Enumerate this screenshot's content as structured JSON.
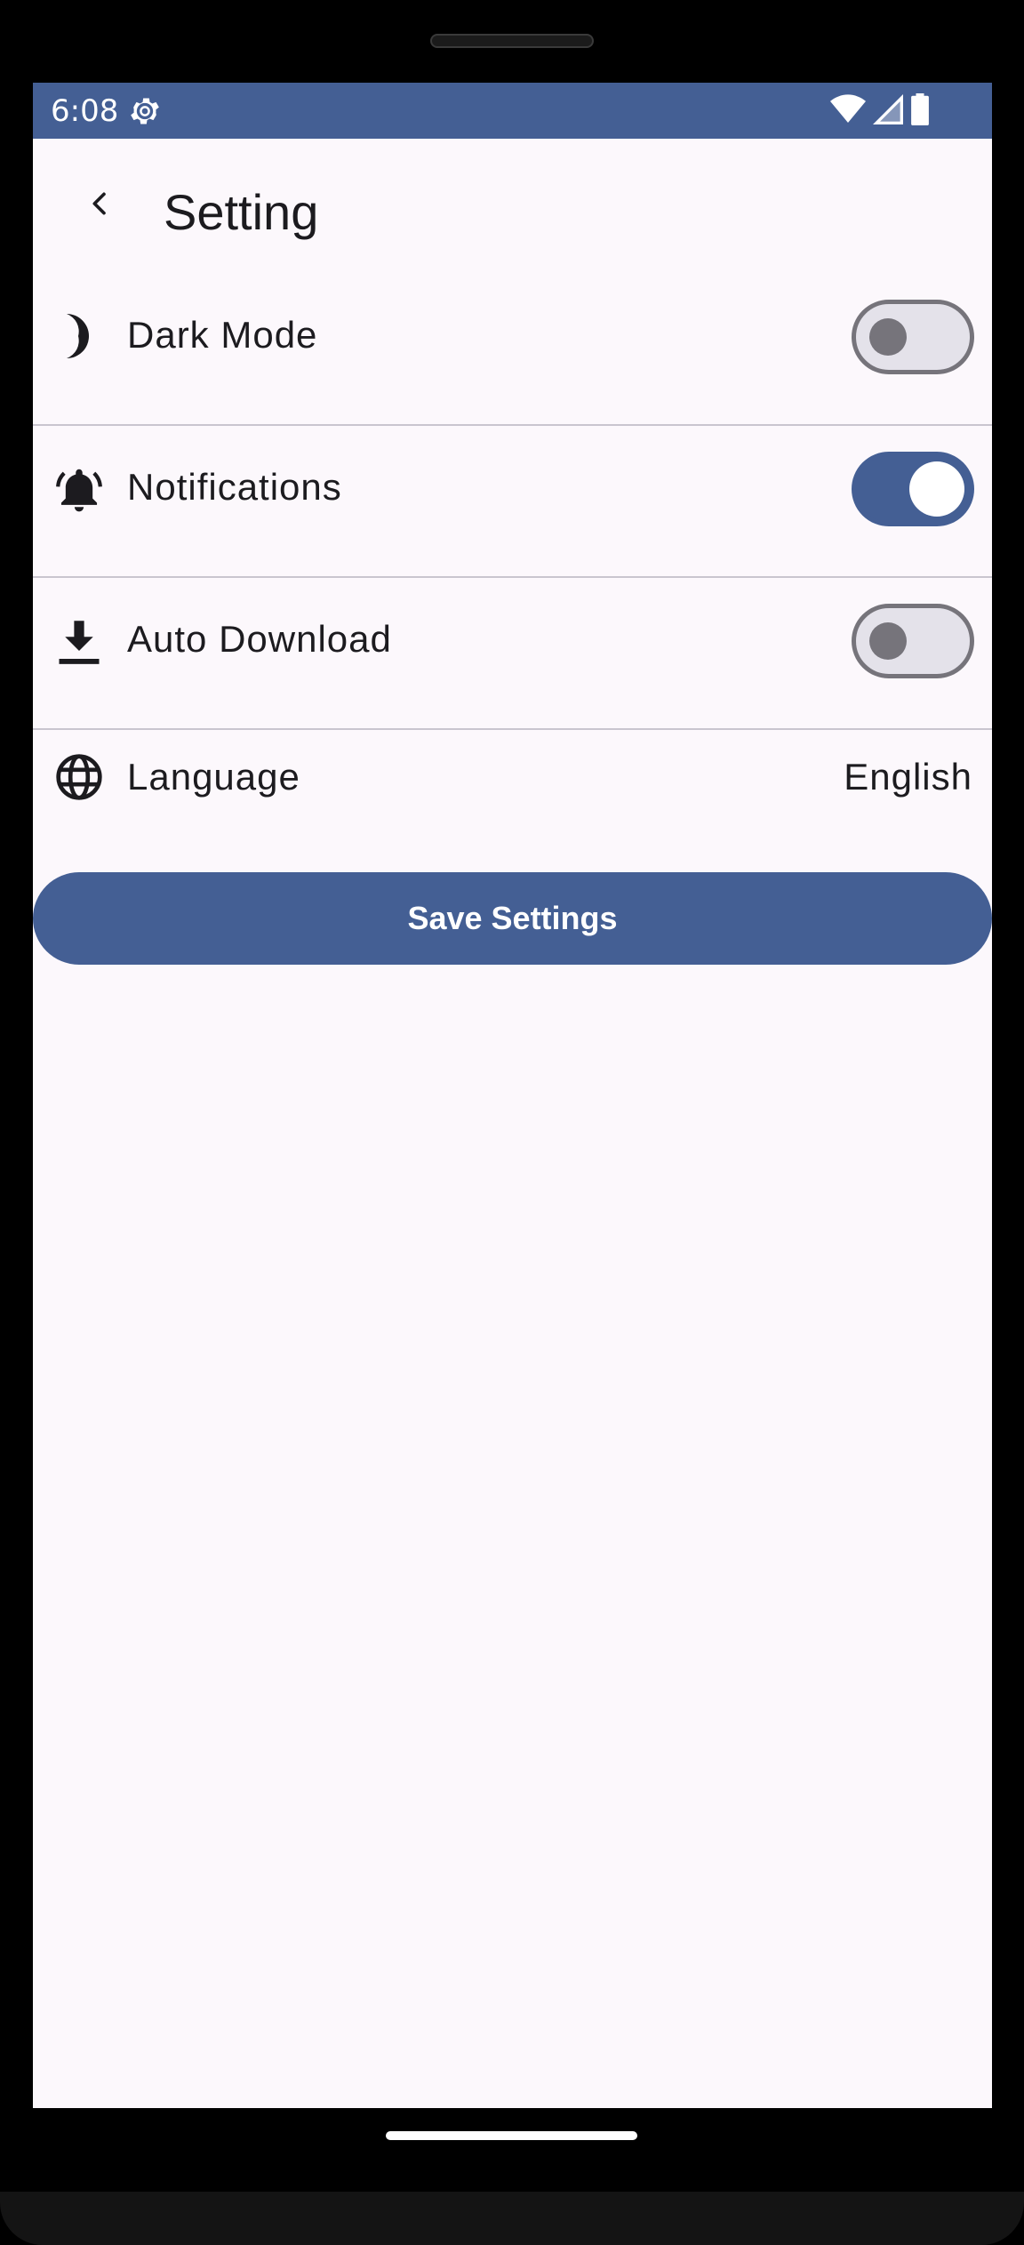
{
  "status_bar": {
    "time": "6:08",
    "icons": [
      "settings-gear-icon",
      "wifi-icon",
      "signal-icon",
      "battery-icon"
    ],
    "background": "#445f94"
  },
  "header": {
    "title": "Setting",
    "back_icon": "chevron-left-icon"
  },
  "settings": [
    {
      "label": "Dark Mode",
      "icon": "moon-icon",
      "type": "toggle",
      "enabled": false
    },
    {
      "label": "Notifications",
      "icon": "bell-ringing-icon",
      "type": "toggle",
      "enabled": true
    },
    {
      "label": "Auto Download",
      "icon": "download-icon",
      "type": "toggle",
      "enabled": false
    },
    {
      "label": "Language",
      "icon": "globe-icon",
      "type": "value",
      "value": "English"
    }
  ],
  "save_button": {
    "label": "Save Settings"
  },
  "colors": {
    "primary": "#445f94",
    "surface": "#fcf8fc",
    "on_surface": "#1c1b1f",
    "outline": "#76747b",
    "divider": "#c9c5cf"
  }
}
